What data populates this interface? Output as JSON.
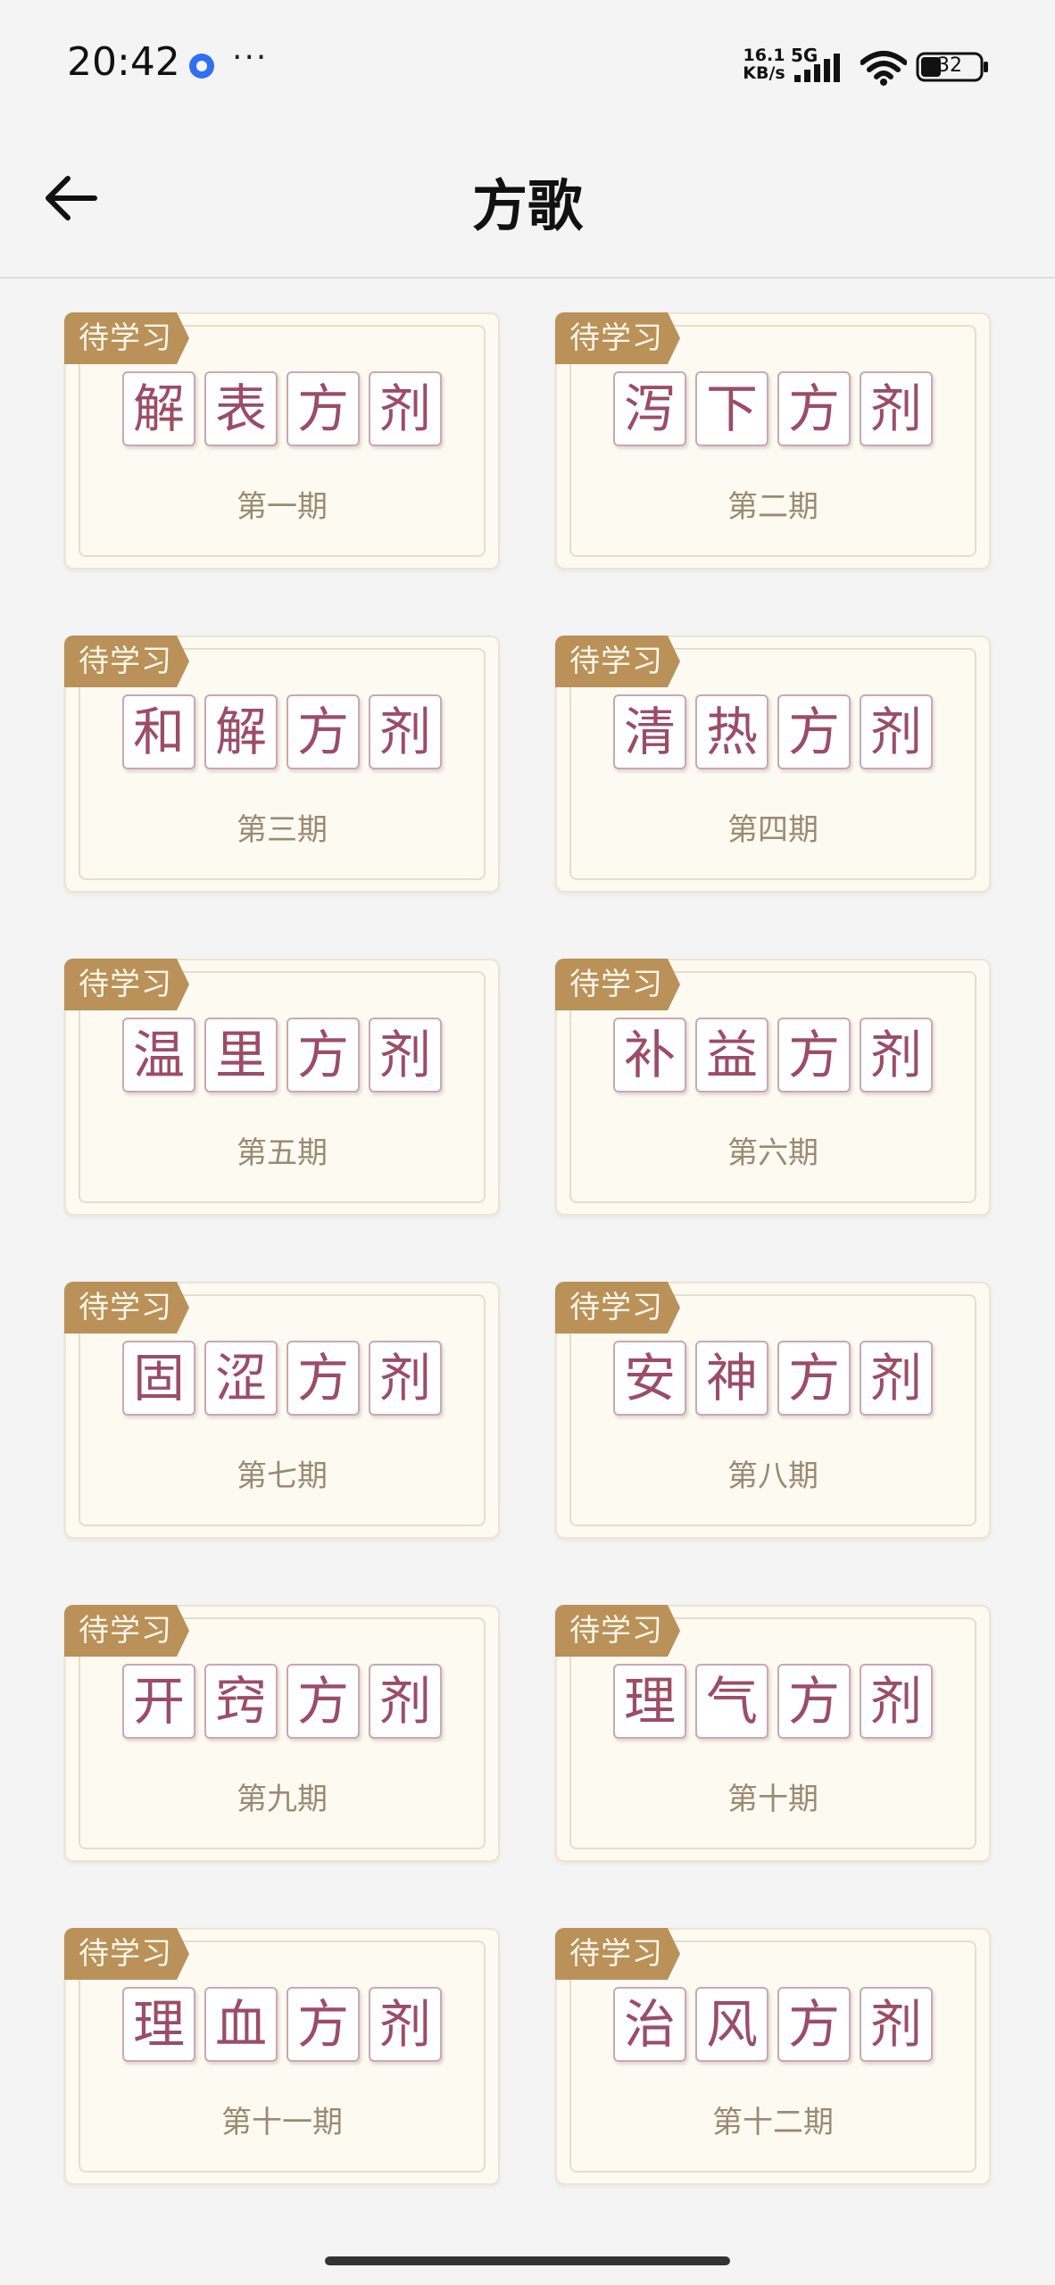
{
  "status_bar": {
    "time": "20:42",
    "more": "···",
    "net_speed_value": "16.1",
    "net_speed_unit": "KB/s",
    "network_type": "5G",
    "battery_level": "32",
    "icons": [
      "app-notification-icon",
      "signal-icon",
      "wifi-icon",
      "battery-icon"
    ]
  },
  "header": {
    "title": "方歌",
    "back_icon": "arrow-left-icon"
  },
  "colors": {
    "background": "#f4f4f4",
    "card_background": "#fdfaf2",
    "badge": "#b99159",
    "char_text": "#9b4d66",
    "period_text": "#9a8a72"
  },
  "cards": [
    {
      "badge": "待学习",
      "chars": [
        "解",
        "表",
        "方",
        "剂"
      ],
      "period": "第一期"
    },
    {
      "badge": "待学习",
      "chars": [
        "泻",
        "下",
        "方",
        "剂"
      ],
      "period": "第二期"
    },
    {
      "badge": "待学习",
      "chars": [
        "和",
        "解",
        "方",
        "剂"
      ],
      "period": "第三期"
    },
    {
      "badge": "待学习",
      "chars": [
        "清",
        "热",
        "方",
        "剂"
      ],
      "period": "第四期"
    },
    {
      "badge": "待学习",
      "chars": [
        "温",
        "里",
        "方",
        "剂"
      ],
      "period": "第五期"
    },
    {
      "badge": "待学习",
      "chars": [
        "补",
        "益",
        "方",
        "剂"
      ],
      "period": "第六期"
    },
    {
      "badge": "待学习",
      "chars": [
        "固",
        "涩",
        "方",
        "剂"
      ],
      "period": "第七期"
    },
    {
      "badge": "待学习",
      "chars": [
        "安",
        "神",
        "方",
        "剂"
      ],
      "period": "第八期"
    },
    {
      "badge": "待学习",
      "chars": [
        "开",
        "窍",
        "方",
        "剂"
      ],
      "period": "第九期"
    },
    {
      "badge": "待学习",
      "chars": [
        "理",
        "气",
        "方",
        "剂"
      ],
      "period": "第十期"
    },
    {
      "badge": "待学习",
      "chars": [
        "理",
        "血",
        "方",
        "剂"
      ],
      "period": "第十一期"
    },
    {
      "badge": "待学习",
      "chars": [
        "治",
        "风",
        "方",
        "剂"
      ],
      "period": "第十二期"
    }
  ]
}
